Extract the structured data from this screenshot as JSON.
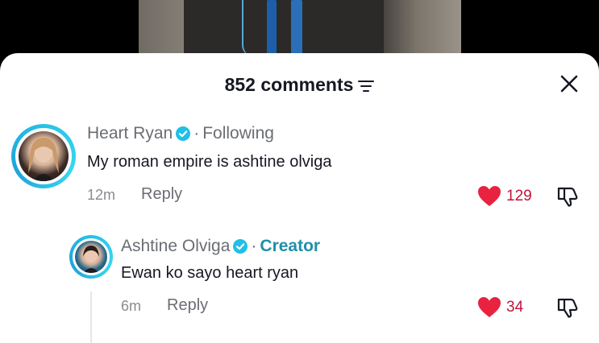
{
  "header": {
    "comments_label": "852 comments",
    "close_icon": "close-icon",
    "filter_icon": "filter-icon"
  },
  "comments": [
    {
      "author": "Heart Ryan",
      "verified": true,
      "relation": "Following",
      "text": "My roman empire is ashtine olviga",
      "time": "12m",
      "reply_label": "Reply",
      "likes": "129"
    },
    {
      "author": "Ashtine Olviga",
      "verified": true,
      "relation": "Creator",
      "text": "Ewan ko sayo heart ryan",
      "time": "6m",
      "reply_label": "Reply",
      "likes": "34"
    }
  ],
  "colors": {
    "like_red": "#e8223f",
    "verified_blue": "#20c0e8",
    "creator_teal": "#1f8fa8",
    "avatar_ring": "#25c2e6"
  }
}
